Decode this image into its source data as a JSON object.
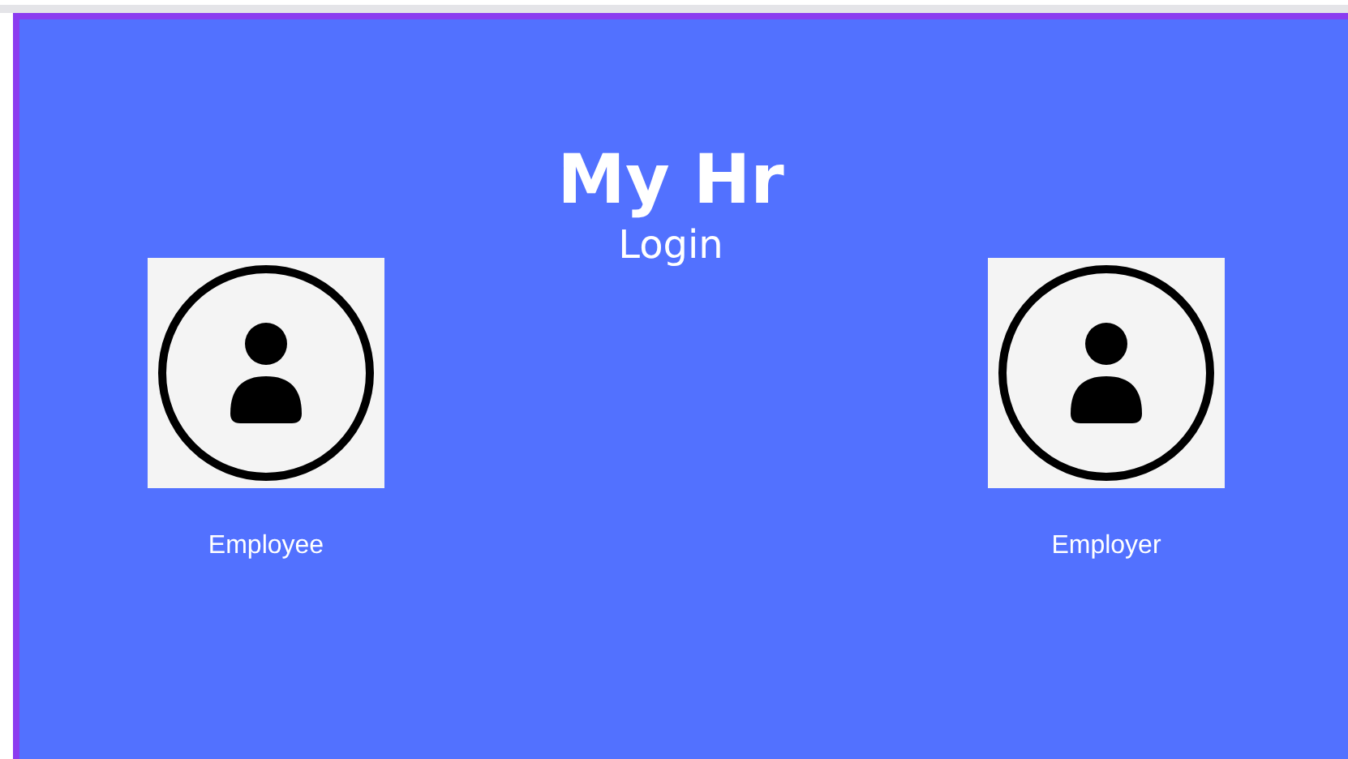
{
  "title": "My Hr",
  "subtitle": "Login",
  "roles": [
    {
      "label": "Employee"
    },
    {
      "label": "Employer"
    }
  ]
}
